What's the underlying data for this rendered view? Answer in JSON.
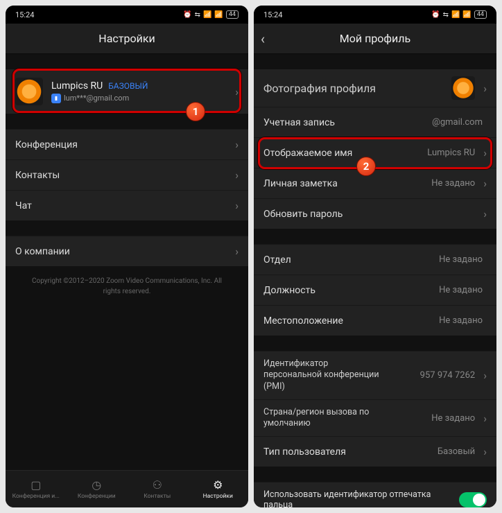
{
  "time": "15:24",
  "battery": "44",
  "left": {
    "title": "Настройки",
    "profile": {
      "name": "Lumpics RU",
      "plan": "БАЗОВЫЙ",
      "email": "lum***@gmail.com"
    },
    "items": {
      "conference": "Конференция",
      "contacts": "Контакты",
      "chat": "Чат",
      "about": "О компании"
    },
    "copyright": "Copyright ©2012–2020 Zoom Video Communications, Inc. All rights reserved.",
    "tabs": {
      "t1": "Конференция и...",
      "t2": "Конференции",
      "t3": "Контакты",
      "t4": "Настройки"
    }
  },
  "right": {
    "title": "Мой профиль",
    "rows": {
      "photo": "Фотография профиля",
      "account": {
        "label": "Учетная запись",
        "value": "@gmail.com"
      },
      "displayName": {
        "label": "Отображаемое имя",
        "value": "Lumpics RU"
      },
      "note": {
        "label": "Личная заметка",
        "value": "Не задано"
      },
      "password": "Обновить пароль",
      "dept": {
        "label": "Отдел",
        "value": "Не задано"
      },
      "job": {
        "label": "Должность",
        "value": "Не задано"
      },
      "location": {
        "label": "Местоположение",
        "value": "Не задано"
      },
      "pmi": {
        "label": "Идентификатор персональной конференции (PMI)",
        "value": "957 974 7262"
      },
      "callRegion": {
        "label": "Страна/регион вызова по умолчанию",
        "value": "Не задано"
      },
      "userType": {
        "label": "Тип пользователя",
        "value": "Базовый"
      },
      "fingerprint": "Использовать идентификатор отпечатка пальца"
    }
  },
  "badges": {
    "b1": "1",
    "b2": "2"
  }
}
